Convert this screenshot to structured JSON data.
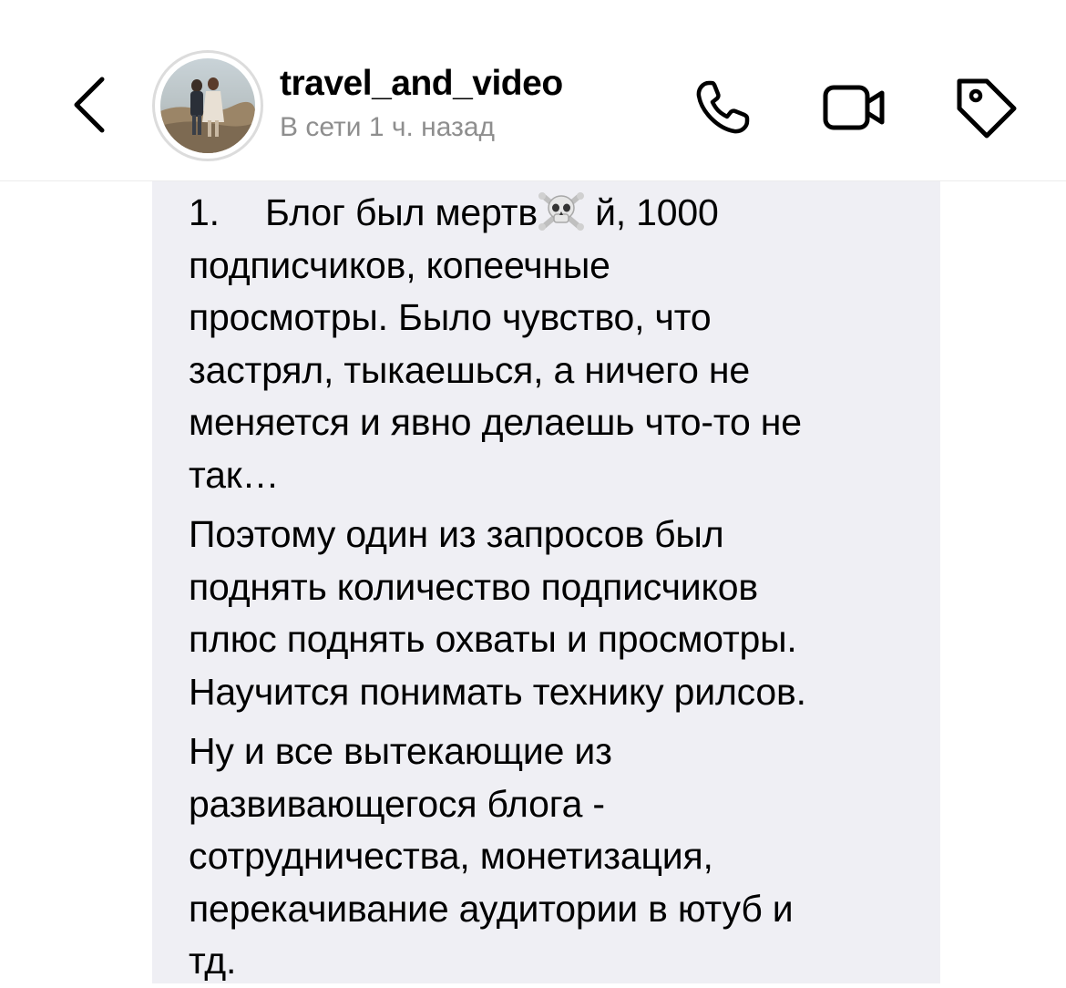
{
  "header": {
    "username": "travel_and_video",
    "status": "В сети 1 ч. назад",
    "icons": {
      "back": "chevron-left-icon",
      "call": "phone-icon",
      "video": "video-camera-icon",
      "tag": "tag-icon"
    }
  },
  "message": {
    "list_number": "1.",
    "first_line_before_emoji": "Блог был мертв",
    "emoji": "skull-and-crossbones",
    "first_line_after_emoji": " й, 1000",
    "lines_para1": [
      "подписчиков, копеечные",
      "просмотры. Было чувство, что",
      "застрял, тыкаешься, а ничего не",
      "меняется и явно делаешь что-то не",
      "так…"
    ],
    "lines_para2": [
      "Поэтому один из запросов был",
      "поднять количество подписчиков",
      "плюс поднять охваты и просмотры.",
      "Научится понимать технику рилсов."
    ],
    "lines_para3": [
      "Ну и все вытекающие из",
      "развивающегося блога -",
      "сотрудничества, монетизация,",
      "перекачивание аудитории в ютуб и",
      "тд."
    ]
  },
  "colors": {
    "bubble_bg": "#efeff4",
    "status_text": "#8e8e8e",
    "divider": "#ececec"
  }
}
